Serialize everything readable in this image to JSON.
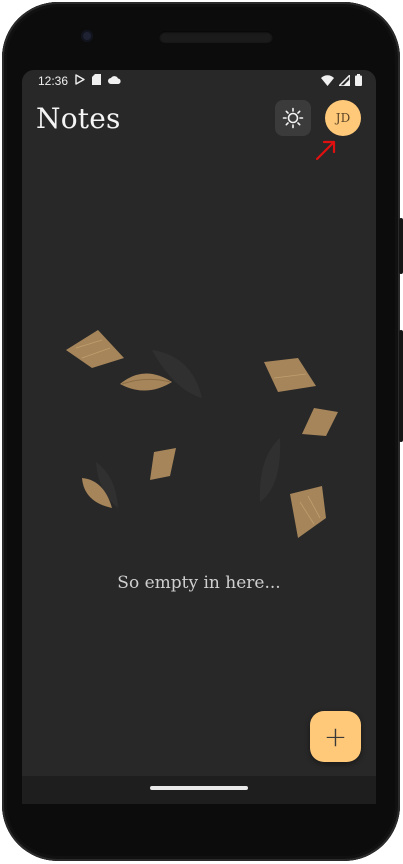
{
  "status_bar": {
    "time": "12:36",
    "left_icons": [
      "play-store-icon",
      "sd-card-icon",
      "cloud-icon"
    ],
    "right_icons": [
      "wifi-icon",
      "signal-icon",
      "battery-icon"
    ]
  },
  "header": {
    "title": "Notes",
    "theme_toggle_icon": "sun-icon",
    "avatar_initials": "JD"
  },
  "annotation": {
    "arrow_color": "#e01010"
  },
  "empty_state": {
    "message": "So empty in here...",
    "illustration_icon": "floating-notes-illustration"
  },
  "fab": {
    "label": "+"
  },
  "colors": {
    "background": "#282828",
    "accent": "#ffc979",
    "paper": "#a6855a"
  }
}
